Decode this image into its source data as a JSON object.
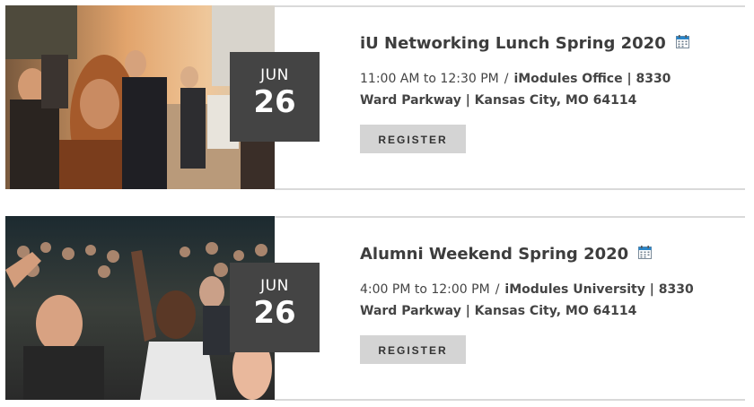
{
  "events": [
    {
      "title": "iU Networking Lunch Spring 2020",
      "month": "JUN",
      "day": "26",
      "time": "11:00 AM to 12:30 PM",
      "separator": "/",
      "location_line1": "iModules Office | 8330",
      "location_line2": "Ward Parkway | Kansas City, MO 64114",
      "register_label": "REGISTER",
      "image": "networking-lunch-crowd-photo"
    },
    {
      "title": "Alumni Weekend Spring 2020",
      "month": "JUN",
      "day": "26",
      "time": "4:00 PM to 12:00 PM",
      "separator": "/",
      "location_line1": "iModules University | 8330",
      "location_line2": "Ward Parkway | Kansas City, MO 64114",
      "register_label": "REGISTER",
      "image": "concert-crowd-photo"
    }
  ],
  "icons": {
    "calendar": "calendar-icon"
  },
  "colors": {
    "badge_bg": "#444444",
    "button_bg": "#d4d4d4",
    "calendar_accent": "#2a86c9"
  }
}
